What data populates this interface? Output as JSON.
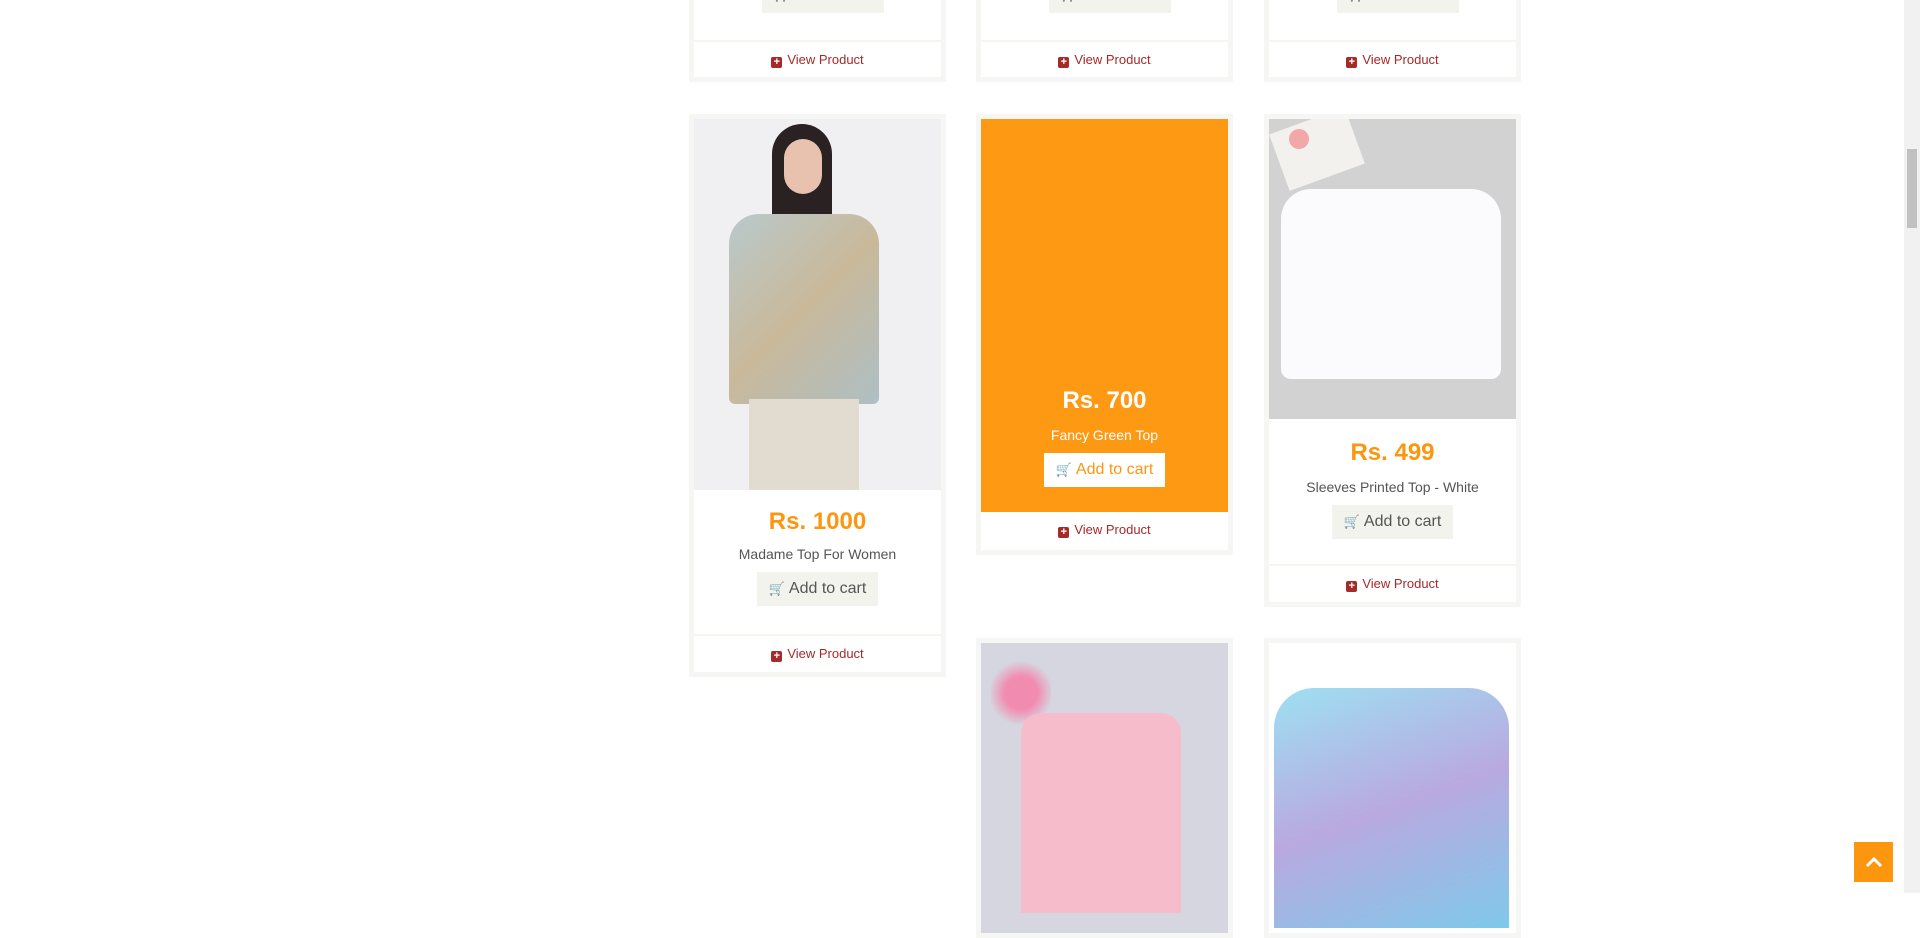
{
  "common": {
    "add_to_cart": "Add to cart",
    "view_product": "View Product"
  },
  "top_row": [
    {},
    {},
    {}
  ],
  "products": [
    {
      "price": "Rs. 1000",
      "name": "Madame Top For Women"
    },
    {
      "price": "Rs. 700",
      "name": "Fancy Green Top"
    },
    {
      "price": "Rs. 499",
      "name": "Sleeves Printed Top - White"
    }
  ],
  "colors": {
    "accent": "#fd960f",
    "link": "#a52a2a",
    "button_bg": "#f3f3ed"
  },
  "icons": {
    "cart": "shopping-cart-icon",
    "view": "plus-square-icon",
    "top": "chevron-up-icon"
  }
}
